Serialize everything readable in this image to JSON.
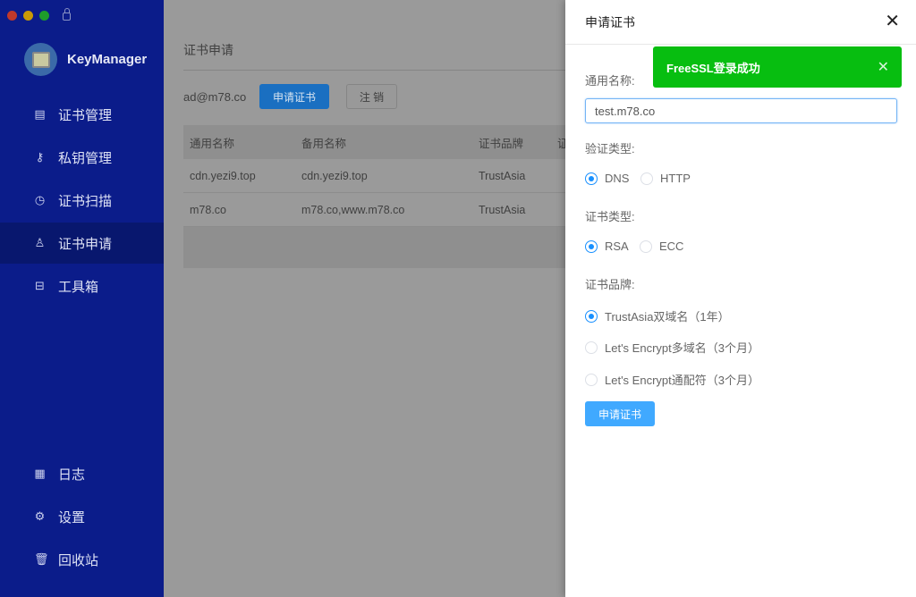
{
  "app": {
    "name": "KeyManager"
  },
  "sidebar": {
    "items": [
      {
        "label": "证书管理",
        "icon": "certificate-icon"
      },
      {
        "label": "私钥管理",
        "icon": "key-icon"
      },
      {
        "label": "证书扫描",
        "icon": "scan-icon"
      },
      {
        "label": "证书申请",
        "icon": "user-icon",
        "active": true
      },
      {
        "label": "工具箱",
        "icon": "toolbox-icon"
      },
      {
        "label": "日志",
        "icon": "log-icon"
      },
      {
        "label": "设置",
        "icon": "gear-icon"
      },
      {
        "label": "回收站",
        "icon": "trash-icon"
      }
    ]
  },
  "main": {
    "title": "证书申请",
    "email": "ad@m78.co",
    "apply_label": "申请证书",
    "logout_label": "注 销",
    "table": {
      "headers": [
        "通用名称",
        "备用名称",
        "证书品牌",
        "证"
      ],
      "rows": [
        [
          "cdn.yezi9.top",
          "cdn.yezi9.top",
          "TrustAsia"
        ],
        [
          "m78.co",
          "m78.co,www.m78.co",
          "TrustAsia"
        ]
      ]
    }
  },
  "drawer": {
    "title": "申请证书",
    "common_name_label": "通用名称:",
    "common_name_value": "test.m78.co",
    "verify_label": "验证类型:",
    "verify_options": [
      "DNS",
      "HTTP"
    ],
    "verify_selected": "DNS",
    "type_label": "证书类型:",
    "type_options": [
      "RSA",
      "ECC"
    ],
    "type_selected": "RSA",
    "brand_label": "证书品牌:",
    "brand_options": [
      "TrustAsia双域名（1年）",
      "Let's Encrypt多域名（3个月）",
      "Let's Encrypt通配符（3个月）"
    ],
    "brand_selected": "TrustAsia双域名（1年）",
    "submit_label": "申请证书"
  },
  "toast": {
    "message": "FreeSSL登录成功",
    "color": "#07be10"
  },
  "colors": {
    "sidebar": "#0b1c8a",
    "accent": "#1890ff"
  }
}
